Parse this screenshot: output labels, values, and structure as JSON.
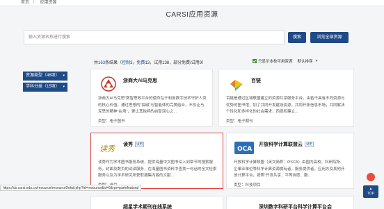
{
  "breadcrumb": {
    "home": "首页",
    "sep": "〉",
    "current": "应用资源"
  },
  "page_title": "CARSI应用资源",
  "search": {
    "placeholder": "输入资源名称进行搜索",
    "search_btn": "搜索",
    "all_btn": "浏览全部资源"
  },
  "results": {
    "prefix": "共",
    "total": "163",
    "mid1": "条结果（",
    "controlled_label": "控制",
    "controlled_count": "3",
    "sep1": "，",
    "free_label": "免费",
    "free_count": "13",
    "rest": "，试用138，部分免费/试用9）"
  },
  "filters": {
    "only_auth_label": "只显示本校可用资源",
    "sort_label": "默认排序",
    "sort_caret": "▼"
  },
  "side_filters": [
    {
      "label": "资源类型（46项）",
      "arrow": "▾"
    },
    {
      "label": "学科分类（15项）",
      "arrow": "▾"
    }
  ],
  "cards": [
    {
      "title": "浙商大AI马克思",
      "tag": "",
      "desc": "浙商大AI马克思\"数智思政平台的使命在于利用数字技术守护人类的核心价值，通过思想的\"探磁\"与智能体的完美结合，不仅让马克思的精神\"在场\"，更让其独特的启智润心之...",
      "type": "类型：电子图书",
      "logo": "马"
    },
    {
      "title": "百链",
      "tag": "免费",
      "desc": "百链是通过区域联盟建立的资源共享服务平台，由若干具有不同资源与优势的图书馆，加了共同开发建设资源，共同开拓信息市场，共同解决个性化和多样化的社会需求，西提权建立...",
      "type": "类型：电子期刊",
      "logo": ""
    },
    {
      "title": "读秀",
      "tag": "试用",
      "desc": "读秀作为学术图书服务系统，提供海量中文图书深入到章节的搜索服务，封面及数页的试读服务，在海量图书资料中查找一句话的全文检索服务以及为学术研究所获取搜集内容的文献...",
      "type": "类型：书目",
      "logo": "读秀"
    },
    {
      "title": "开放科学计算联盟云",
      "tag": "试用",
      "desc": "开放科学计算联盟（英文简称：OSCA）由国内高校、科研院所、企事业单位等科学计算资源拥有者，服务提供者，应用方及其他开放计算平台，按照\"开发共享、平等自愿、服...",
      "type": "类型：科技项目",
      "logo": "OCA"
    }
  ],
  "partial_cards": [
    {
      "title": "超星学术期刊在线系统"
    },
    {
      "title": "深圳数字科研平台科学计算平台会"
    }
  ],
  "status_url": "https://ds.carsi.edu.cn/resource/resourceDetail.php?id=resource&id=6&rpr=partofnatural",
  "top_btn": {
    "label": "TOP",
    "arrow": "▲"
  }
}
